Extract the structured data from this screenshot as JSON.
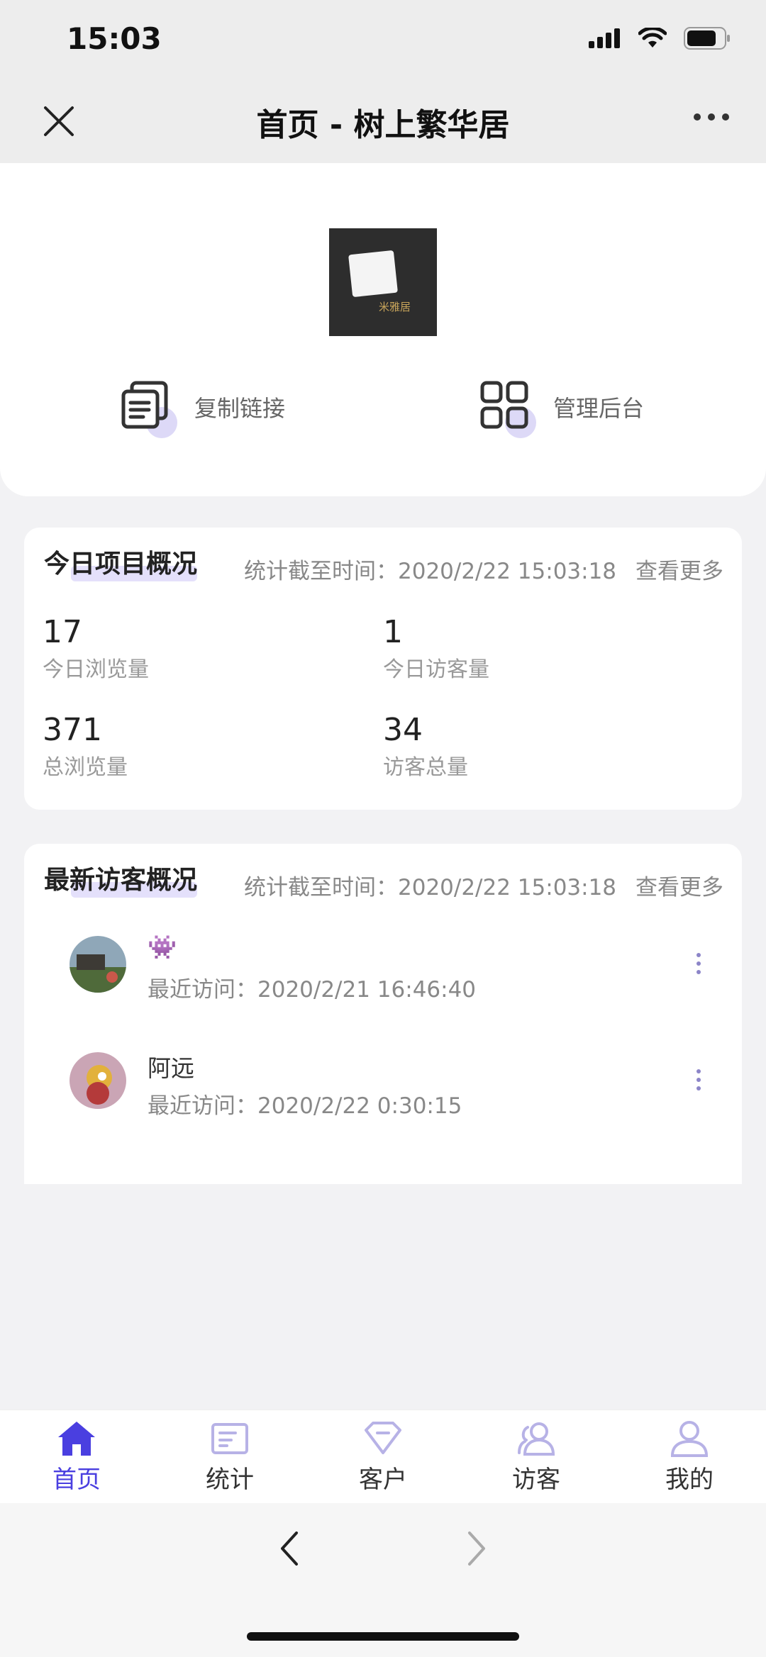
{
  "status_bar": {
    "time": "15:03"
  },
  "nav": {
    "title": "首页 - 树上繁华居"
  },
  "top_card": {
    "logo_text": "米雅居",
    "copy_link_label": "复制链接",
    "admin_label": "管理后台"
  },
  "overview": {
    "title": "今日项目概况",
    "time": "统计截至时间：2020/2/22 15:03:18",
    "more": "查看更多",
    "stats": [
      {
        "value": "17",
        "label": "今日浏览量"
      },
      {
        "value": "1",
        "label": "今日访客量"
      },
      {
        "value": "371",
        "label": "总浏览量"
      },
      {
        "value": "34",
        "label": "访客总量"
      }
    ]
  },
  "visitors": {
    "title": "最新访客概况",
    "time": "统计截至时间：2020/2/22 15:03:18",
    "more": "查看更多",
    "items": [
      {
        "name": "👾",
        "last_visit": "最近访问：2020/2/21 16:46:40"
      },
      {
        "name": "阿远",
        "last_visit": "最近访问：2020/2/22 0:30:15"
      }
    ]
  },
  "tabbar": {
    "tabs": [
      {
        "label": "首页",
        "icon": "home-icon"
      },
      {
        "label": "统计",
        "icon": "stats-icon"
      },
      {
        "label": "客户",
        "icon": "customer-icon"
      },
      {
        "label": "访客",
        "icon": "visitor-icon"
      },
      {
        "label": "我的",
        "icon": "user-icon"
      }
    ],
    "active_index": 0
  },
  "colors": {
    "accent": "#4a3fe0",
    "accent_light": "#ddd9f7"
  }
}
